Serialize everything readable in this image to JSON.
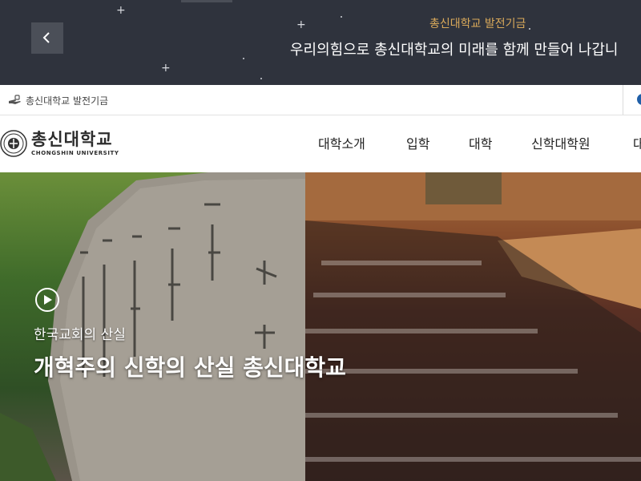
{
  "banner": {
    "subtitle": "총신대학교 발전기금",
    "title": "우리의힘으로 총신대학교의 미래를 함께 만들어 나갑니",
    "prev_icon": "chevron-left-icon",
    "background": "#2f333d",
    "accent": "#d9a95a"
  },
  "utility": {
    "fund_link": "총신대학교 발전기금",
    "fund_icon": "donation-hand-icon"
  },
  "logo": {
    "name": "총신대학교",
    "name_en": "CHONGSHIN UNIVERSITY"
  },
  "nav": {
    "items": [
      "대학소개",
      "입학",
      "대학",
      "신학대학원",
      "대"
    ]
  },
  "hero": {
    "subtitle": "한국교회의 산실",
    "title": "개혁주의 신학의 산실 총신대학교",
    "play_icon": "play-icon"
  }
}
